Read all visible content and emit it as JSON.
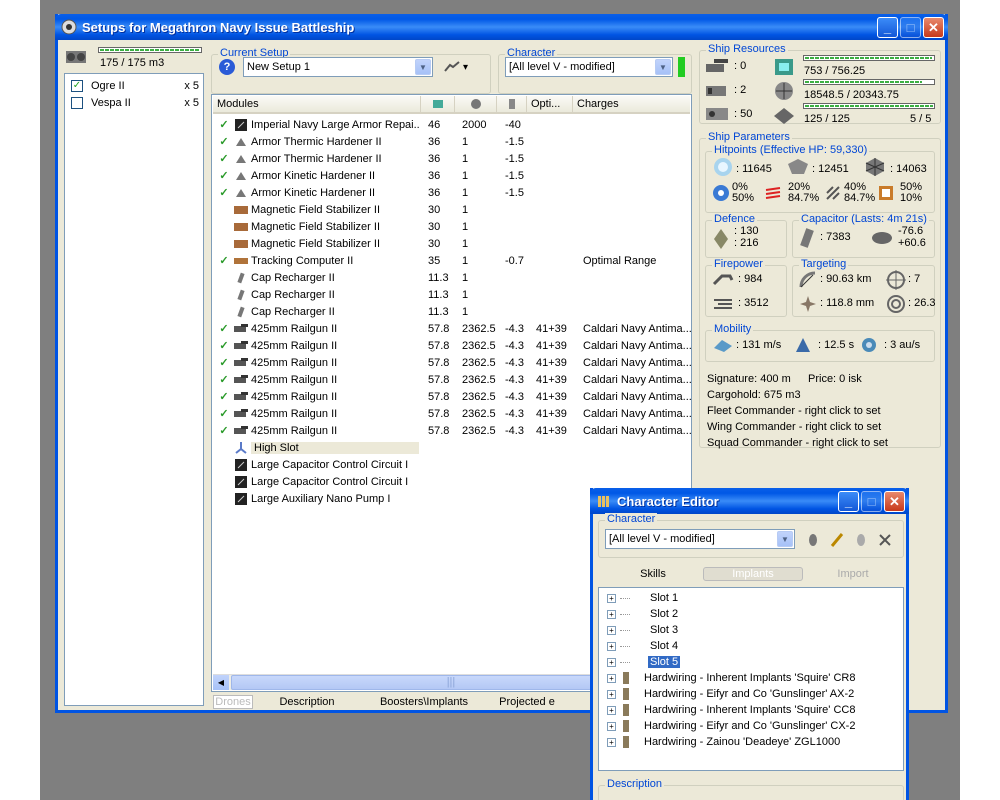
{
  "main_window": {
    "title": "Setups for Megathron Navy Issue Battleship",
    "left_panel": {
      "drone_bay": "175 / 175 m3",
      "drones": [
        {
          "name": "Ogre II",
          "qty": "x 5",
          "checked": true
        },
        {
          "name": "Vespa II",
          "qty": "x 5",
          "checked": false
        }
      ]
    },
    "current_setup": {
      "label": "Current Setup",
      "value": "New Setup 1"
    },
    "character": {
      "label": "Character",
      "value": "[All level V - modified]"
    },
    "modules_header": {
      "modules": "Modules",
      "opti": "Opti...",
      "charges": "Charges"
    },
    "modules": [
      {
        "name": "Imperial Navy Large Armor Repai...",
        "cpu": "46",
        "pg": "2000",
        "cap": "-40",
        "opt": "",
        "charge": "",
        "check": true
      },
      {
        "name": "Armor Thermic Hardener II",
        "cpu": "36",
        "pg": "1",
        "cap": "-1.5",
        "opt": "",
        "charge": "",
        "check": true
      },
      {
        "name": "Armor Thermic Hardener II",
        "cpu": "36",
        "pg": "1",
        "cap": "-1.5",
        "opt": "",
        "charge": "",
        "check": true
      },
      {
        "name": "Armor Kinetic Hardener II",
        "cpu": "36",
        "pg": "1",
        "cap": "-1.5",
        "opt": "",
        "charge": "",
        "check": true
      },
      {
        "name": "Armor Kinetic Hardener II",
        "cpu": "36",
        "pg": "1",
        "cap": "-1.5",
        "opt": "",
        "charge": "",
        "check": true
      },
      {
        "name": "Magnetic Field Stabilizer II",
        "cpu": "30",
        "pg": "1",
        "cap": "",
        "opt": "",
        "charge": "",
        "check": false
      },
      {
        "name": "Magnetic Field Stabilizer II",
        "cpu": "30",
        "pg": "1",
        "cap": "",
        "opt": "",
        "charge": "",
        "check": false
      },
      {
        "name": "Magnetic Field Stabilizer II",
        "cpu": "30",
        "pg": "1",
        "cap": "",
        "opt": "",
        "charge": "",
        "check": false
      },
      {
        "name": "Tracking Computer II",
        "cpu": "35",
        "pg": "1",
        "cap": "-0.7",
        "opt": "",
        "charge": "Optimal Range",
        "check": true
      },
      {
        "name": "Cap Recharger II",
        "cpu": "11.3",
        "pg": "1",
        "cap": "",
        "opt": "",
        "charge": "",
        "check": false
      },
      {
        "name": "Cap Recharger II",
        "cpu": "11.3",
        "pg": "1",
        "cap": "",
        "opt": "",
        "charge": "",
        "check": false
      },
      {
        "name": "Cap Recharger II",
        "cpu": "11.3",
        "pg": "1",
        "cap": "",
        "opt": "",
        "charge": "",
        "check": false
      },
      {
        "name": "425mm Railgun II",
        "cpu": "57.8",
        "pg": "2362.5",
        "cap": "-4.3",
        "opt": "41+39",
        "charge": "Caldari Navy Antima...",
        "check": true
      },
      {
        "name": "425mm Railgun II",
        "cpu": "57.8",
        "pg": "2362.5",
        "cap": "-4.3",
        "opt": "41+39",
        "charge": "Caldari Navy Antima...",
        "check": true
      },
      {
        "name": "425mm Railgun II",
        "cpu": "57.8",
        "pg": "2362.5",
        "cap": "-4.3",
        "opt": "41+39",
        "charge": "Caldari Navy Antima...",
        "check": true
      },
      {
        "name": "425mm Railgun II",
        "cpu": "57.8",
        "pg": "2362.5",
        "cap": "-4.3",
        "opt": "41+39",
        "charge": "Caldari Navy Antima...",
        "check": true
      },
      {
        "name": "425mm Railgun II",
        "cpu": "57.8",
        "pg": "2362.5",
        "cap": "-4.3",
        "opt": "41+39",
        "charge": "Caldari Navy Antima...",
        "check": true
      },
      {
        "name": "425mm Railgun II",
        "cpu": "57.8",
        "pg": "2362.5",
        "cap": "-4.3",
        "opt": "41+39",
        "charge": "Caldari Navy Antima...",
        "check": true
      },
      {
        "name": "425mm Railgun II",
        "cpu": "57.8",
        "pg": "2362.5",
        "cap": "-4.3",
        "opt": "41+39",
        "charge": "Caldari Navy Antima...",
        "check": true
      },
      {
        "name": "High Slot",
        "cpu": "",
        "pg": "",
        "cap": "",
        "opt": "",
        "charge": "",
        "check": false
      },
      {
        "name": "Large Capacitor Control Circuit I",
        "cpu": "",
        "pg": "",
        "cap": "",
        "opt": "",
        "charge": "",
        "check": false
      },
      {
        "name": "Large Capacitor Control Circuit I",
        "cpu": "",
        "pg": "",
        "cap": "",
        "opt": "",
        "charge": "",
        "check": false
      },
      {
        "name": "Large Auxiliary Nano Pump I",
        "cpu": "",
        "pg": "",
        "cap": "",
        "opt": "",
        "charge": "",
        "check": false
      }
    ],
    "bottom_tabs": [
      "Drones",
      "Description",
      "Boosters\\Implants",
      "Projected e"
    ],
    "ship_resources": {
      "label": "Ship Resources",
      "turrets": ": 0",
      "launchers": ": 2",
      "calibration": ": 50",
      "cpu": "753 / 756.25",
      "powergrid": "18548.5 / 20343.75",
      "drone_bandwidth": "125 / 125",
      "drones_active": "5 / 5",
      "cpu_fraction": 0.996,
      "pg_fraction": 0.912,
      "bw_fraction": 1.0
    },
    "ship_parameters": {
      "label": "Ship Parameters",
      "hitpoints_label": "Hitpoints (Effective HP: 59,330)",
      "shield_hp": ": 11645",
      "armor_hp": ": 12451",
      "hull_hp": ": 14063",
      "shield_res": [
        "0%",
        "50%"
      ],
      "armor_res": [
        "20%",
        "84.7%"
      ],
      "hull_res": [
        "40%",
        "84.7%"
      ],
      "extra_res": [
        "50%",
        "10%"
      ],
      "defence_label": "Defence",
      "defence": [
        ": 130",
        ": 216"
      ],
      "capacitor_label": "Capacitor (Lasts: 4m 21s)",
      "capacitor": ": 7383",
      "cap_rates": [
        "-76.6",
        "+60.6"
      ],
      "firepower_label": "Firepower",
      "firepower": [
        ": 984",
        ": 3512"
      ],
      "targeting_label": "Targeting",
      "target_range": ": 90.63 km",
      "max_targets": ": 7",
      "scan_res": ": 118.8 mm",
      "sensor": ": 26.3",
      "mobility_label": "Mobility",
      "speed": ": 131 m/s",
      "align": ": 12.5 s",
      "warp": ": 3 au/s",
      "signature": "Signature: 400 m",
      "price": "Price: 0 isk",
      "cargohold": "Cargohold: 675 m3",
      "fleet_cmd": "Fleet Commander - right click to set",
      "wing_cmd": "Wing Commander - right click to set",
      "squad_cmd": "Squad Commander - right click to set"
    }
  },
  "char_editor": {
    "title": "Character Editor",
    "character_label": "Character",
    "character_value": "[All level V - modified]",
    "tabs": [
      "Skills",
      "Implants",
      "Import"
    ],
    "tree": [
      {
        "label": "Slot 1",
        "icon": false,
        "selected": false
      },
      {
        "label": "Slot 2",
        "icon": false,
        "selected": false
      },
      {
        "label": "Slot 3",
        "icon": false,
        "selected": false
      },
      {
        "label": "Slot 4",
        "icon": false,
        "selected": false
      },
      {
        "label": "Slot 5",
        "icon": false,
        "selected": true
      },
      {
        "label": "Hardwiring - Inherent Implants 'Squire' CR8",
        "icon": true,
        "selected": false
      },
      {
        "label": "Hardwiring - Eifyr and Co 'Gunslinger' AX-2",
        "icon": true,
        "selected": false
      },
      {
        "label": "Hardwiring - Inherent Implants 'Squire' CC8",
        "icon": true,
        "selected": false
      },
      {
        "label": "Hardwiring - Eifyr and Co 'Gunslinger' CX-2",
        "icon": true,
        "selected": false
      },
      {
        "label": "Hardwiring - Zainou 'Deadeye' ZGL1000",
        "icon": true,
        "selected": false
      }
    ],
    "description_label": "Description"
  }
}
